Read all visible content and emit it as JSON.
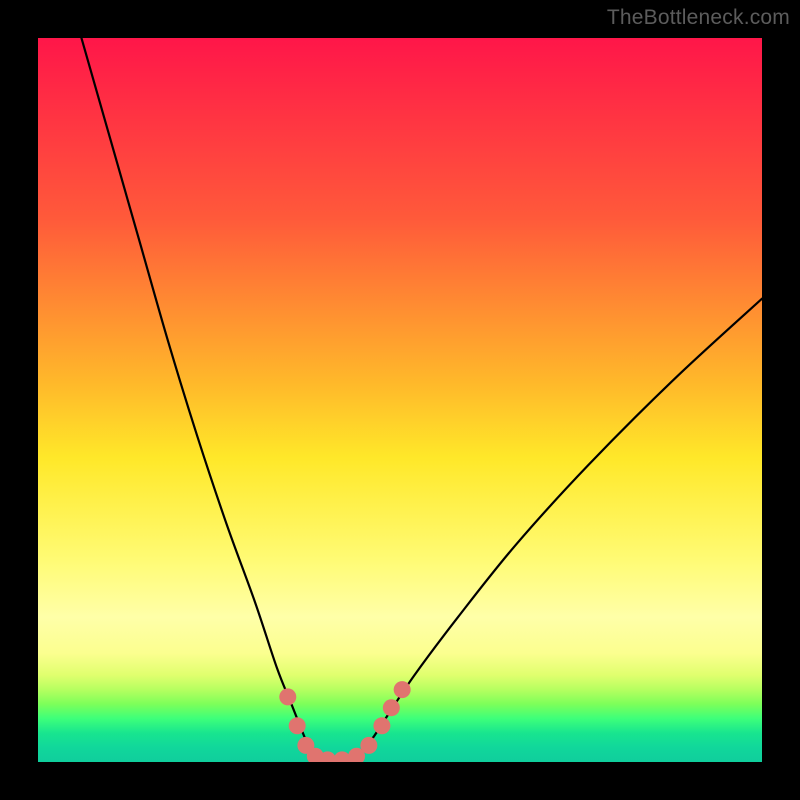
{
  "watermark": "TheBottleneck.com",
  "colors": {
    "frame": "#000000",
    "watermark": "#5c5c5c",
    "curve": "#000000",
    "markers": "#e0746f",
    "green_bottom": "#0fce9c"
  },
  "chart_data": {
    "type": "line",
    "title": "",
    "xlabel": "",
    "ylabel": "",
    "xlim": [
      0,
      100
    ],
    "ylim": [
      0,
      100
    ],
    "notes": "V-shaped bottleneck curve; minimum value ~0 near x≈38–44. Single continuous black curve over vertical red→green spectral gradient. Small salmon dots sit on the curve near the valley floor. No axis tick labels are visible.",
    "series": [
      {
        "name": "bottleneck-curve",
        "x": [
          6,
          10,
          14,
          18,
          22,
          26,
          30,
          33,
          35,
          37,
          38,
          40,
          42,
          44,
          46,
          48,
          52,
          58,
          66,
          76,
          88,
          100
        ],
        "y": [
          100,
          86,
          72,
          58,
          45,
          33,
          22,
          13,
          8,
          3,
          1,
          0,
          0,
          1,
          3,
          6,
          12,
          20,
          30,
          41,
          53,
          64
        ]
      }
    ],
    "markers": [
      {
        "x": 34.5,
        "y": 9
      },
      {
        "x": 35.8,
        "y": 5
      },
      {
        "x": 37.0,
        "y": 2.3
      },
      {
        "x": 38.3,
        "y": 0.8
      },
      {
        "x": 40.0,
        "y": 0.3
      },
      {
        "x": 42.0,
        "y": 0.3
      },
      {
        "x": 44.0,
        "y": 0.8
      },
      {
        "x": 45.7,
        "y": 2.3
      },
      {
        "x": 47.5,
        "y": 5
      },
      {
        "x": 48.8,
        "y": 7.5
      },
      {
        "x": 50.3,
        "y": 10
      }
    ]
  }
}
